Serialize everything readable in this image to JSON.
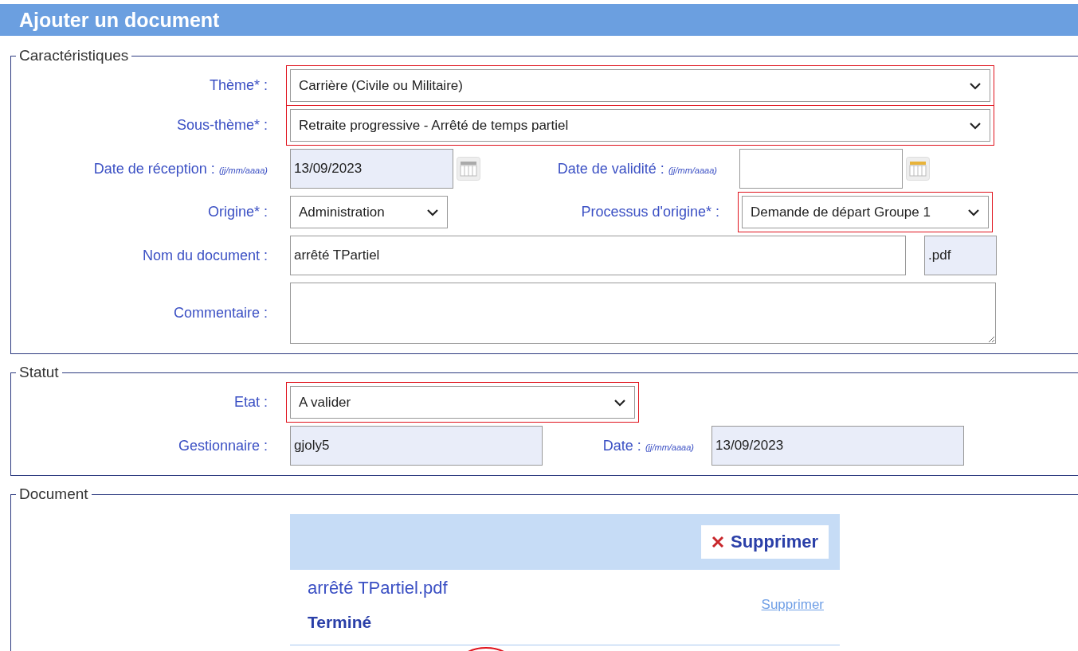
{
  "header": {
    "title": "Ajouter un document"
  },
  "sections": [
    {
      "kind": "characteristics",
      "legend": "Caractéristiques",
      "rows": [
        {
          "fields": [
            {
              "kind": "select",
              "label": "Thème* :",
              "value": "Carrière (Civile ou Militaire)",
              "highlighted": true
            }
          ]
        },
        {
          "fields": [
            {
              "kind": "select",
              "label": "Sous-thème* :",
              "value": "Retraite progressive - Arrêté de temps partiel",
              "highlighted": true
            }
          ]
        },
        {
          "fields": [
            {
              "kind": "date",
              "label": "Date de réception :",
              "hint": "(jj/mm/aaaa)",
              "value": "13/09/2023",
              "disabled": true
            },
            {
              "kind": "date",
              "label": "Date de validité :",
              "hint": "(jj/mm/aaaa)",
              "disabled": false
            }
          ]
        },
        {
          "fields": [
            {
              "kind": "select",
              "label": "Origine* :",
              "value": "Administration",
              "highlighted": false
            },
            {
              "kind": "select",
              "label": "Processus d'origine* :",
              "value": "Demande de départ Groupe 1",
              "highlighted": true
            }
          ]
        },
        {
          "fields": [
            {
              "kind": "text",
              "label": "Nom du document :",
              "value": "arrêté TPartiel",
              "suffix": ".pdf",
              "disabled": false
            }
          ]
        },
        {
          "fields": [
            {
              "kind": "textarea",
              "label": "Commentaire :"
            }
          ]
        }
      ]
    },
    {
      "kind": "status",
      "legend": "Statut",
      "rows": [
        {
          "fields": [
            {
              "kind": "select",
              "label": "Etat :",
              "value": "A valider",
              "highlighted": true
            }
          ]
        },
        {
          "fields": [
            {
              "kind": "text",
              "label": "Gestionnaire :",
              "value": "gjoly5",
              "disabled": true
            },
            {
              "kind": "text",
              "label": "Date :",
              "hint": "(jj/mm/aaaa)",
              "value": "13/09/2023",
              "disabled": true
            }
          ]
        }
      ]
    },
    {
      "kind": "document",
      "legend": "Document",
      "delete_button": "Supprimer",
      "files": [
        {
          "name": "arrêté TPartiel.pdf",
          "status": "Terminé",
          "link": "Supprimer"
        }
      ]
    }
  ],
  "annotation_circle": true
}
